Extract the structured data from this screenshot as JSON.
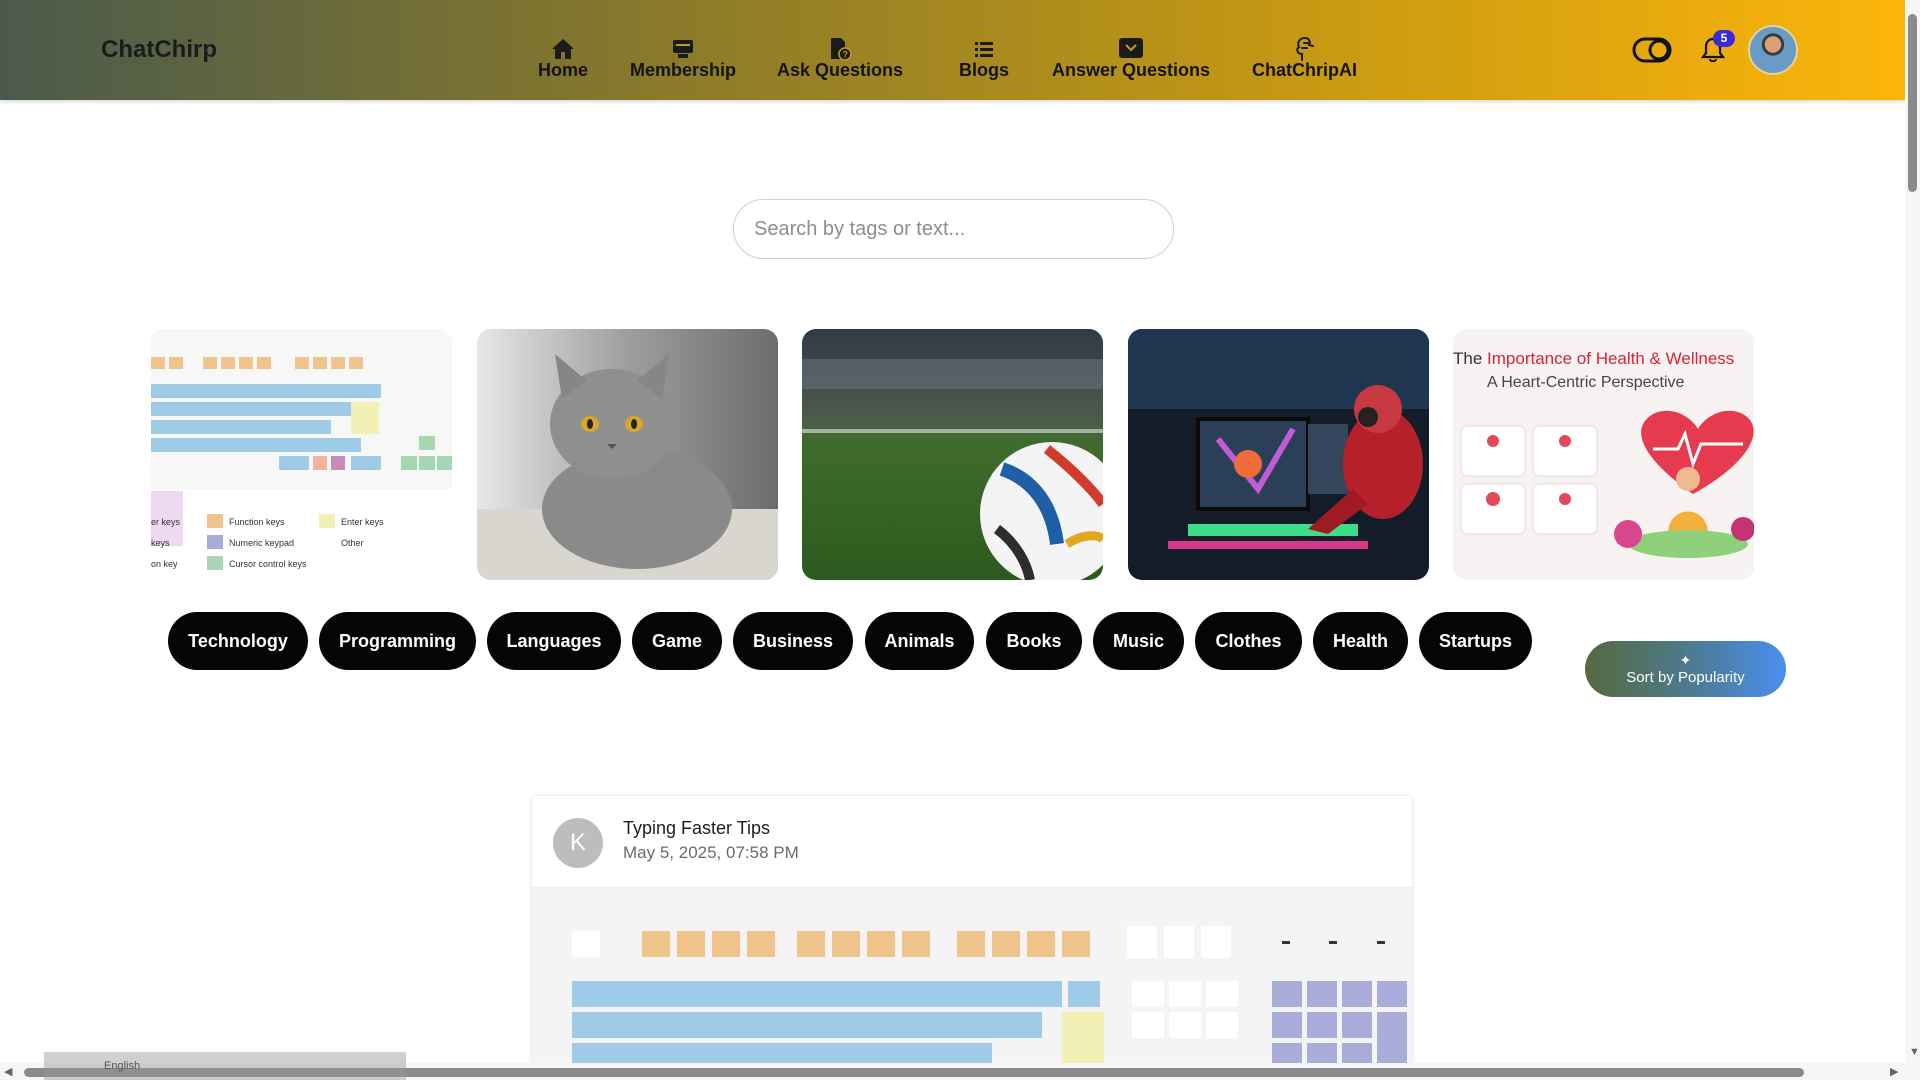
{
  "header": {
    "brand": "ChatChirp",
    "nav": [
      {
        "label": "Home",
        "icon": "home-icon"
      },
      {
        "label": "Membership",
        "icon": "membership-icon"
      },
      {
        "label": "Ask Questions",
        "icon": "ask-icon"
      },
      {
        "label": "Blogs",
        "icon": "blogs-icon"
      },
      {
        "label": "Answer Questions",
        "icon": "answer-icon"
      },
      {
        "label": "ChatChripAI",
        "icon": "ai-icon"
      }
    ],
    "notification_count": "5"
  },
  "search": {
    "placeholder": "Search by tags or text..."
  },
  "carousel": [
    {
      "name": "keyboard-image",
      "lines": [
        "Function keys",
        "Enter keys",
        "Numeric keypad",
        "Other",
        "Cursor control keys",
        "er keys",
        "keys",
        "on key"
      ]
    },
    {
      "name": "cat-image"
    },
    {
      "name": "soccer-ball-image"
    },
    {
      "name": "gamer-image"
    },
    {
      "name": "health-wellness-image",
      "title_prefix": "The ",
      "title_highlight": "Importance of Health & Wellness",
      "subtitle": "A Heart-Centric Perspective"
    }
  ],
  "tags": [
    "Technology",
    "Programming",
    "Languages",
    "Game",
    "Business",
    "Animals",
    "Books",
    "Music",
    "Clothes",
    "Health",
    "Startups"
  ],
  "sort": {
    "label": "Sort by Popularity"
  },
  "post": {
    "avatar_letter": "K",
    "title": "Typing Faster Tips",
    "date": "May 5, 2025, 07:58 PM"
  },
  "taskbar": {
    "language": "English"
  },
  "colors": {
    "header_start": "#4a5a4c",
    "header_end": "#fcb50b",
    "tag_bg": "#050505",
    "sort_start": "#56693f",
    "sort_end": "#4a8ff0",
    "badge": "#3a2bd8"
  }
}
